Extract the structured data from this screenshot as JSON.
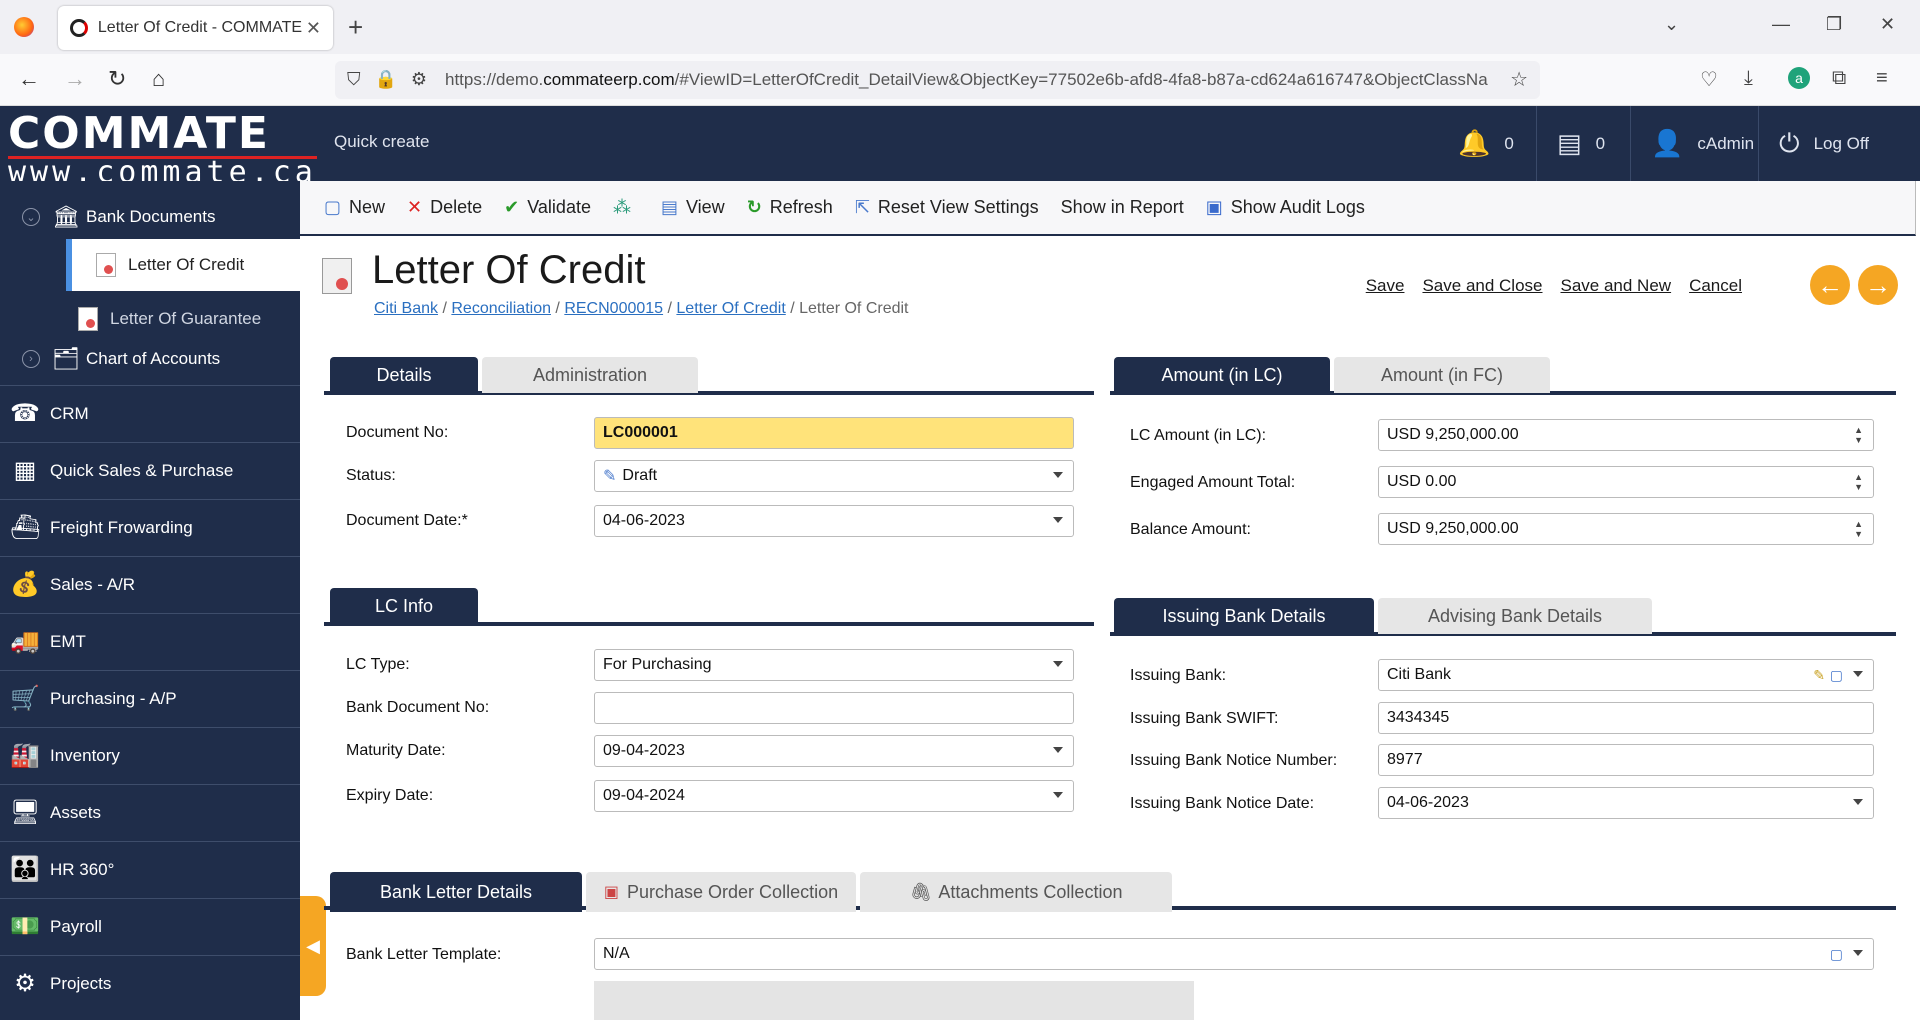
{
  "browser": {
    "tab_title": "Letter Of Credit - COMMATE ERP",
    "url_prefix": "https://demo.",
    "url_domain": "commateerp.com",
    "url_rest": "/#ViewID=LetterOfCredit_DetailView&ObjectKey=77502e6b-afd8-4fa8-b87a-cd624a616747&ObjectClassNa"
  },
  "header": {
    "logo_main": "COMMATE",
    "logo_sub": "www.commate.ca",
    "quick_create": "Quick create",
    "notifications_count": "0",
    "tasks_count": "0",
    "user": "cAdmin",
    "logoff": "Log Off"
  },
  "sidebar": {
    "bank_documents": "Bank Documents",
    "letter_of_credit": "Letter Of Credit",
    "letter_of_guarantee": "Letter Of Guarantee",
    "chart_of_accounts": "Chart of Accounts",
    "menu": [
      "CRM",
      "Quick Sales & Purchase",
      "Freight Frowarding",
      "Sales - A/R",
      "EMT",
      "Purchasing - A/P",
      "Inventory",
      "Assets",
      "HR 360°",
      "Payroll",
      "Projects"
    ]
  },
  "toolbar": {
    "new": "New",
    "delete": "Delete",
    "validate": "Validate",
    "view": "View",
    "refresh": "Refresh",
    "reset_view": "Reset View Settings",
    "show_in_report": "Show in Report",
    "show_audit_logs": "Show Audit Logs"
  },
  "page": {
    "title": "Letter Of Credit",
    "breadcrumb": [
      "Citi Bank",
      "Reconciliation",
      "RECN000015",
      "Letter Of Credit"
    ],
    "breadcrumb_current": "Letter Of Credit",
    "actions": [
      "Save",
      "Save and Close",
      "Save and New",
      "Cancel"
    ]
  },
  "details": {
    "tabs": [
      "Details",
      "Administration"
    ],
    "document_no_label": "Document No:",
    "document_no": "LC000001",
    "status_label": "Status:",
    "status": "Draft",
    "document_date_label": "Document Date:*",
    "document_date": "04-06-2023"
  },
  "amount": {
    "tabs": [
      "Amount (in LC)",
      "Amount (in FC)"
    ],
    "lc_amount_label": "LC Amount (in LC):",
    "lc_amount": "USD 9,250,000.00",
    "engaged_label": "Engaged Amount Total:",
    "engaged": "USD 0.00",
    "balance_label": "Balance Amount:",
    "balance": "USD 9,250,000.00"
  },
  "lc_info": {
    "tab": "LC Info",
    "lc_type_label": "LC Type:",
    "lc_type": "For Purchasing",
    "bank_doc_label": "Bank Document No:",
    "bank_doc": "",
    "maturity_label": "Maturity Date:",
    "maturity": "09-04-2023",
    "expiry_label": "Expiry Date:",
    "expiry": "09-04-2024"
  },
  "bank": {
    "tabs": [
      "Issuing Bank Details",
      "Advising Bank Details"
    ],
    "issuing_bank_label": "Issuing Bank:",
    "issuing_bank": "Citi Bank",
    "swift_label": "Issuing Bank SWIFT:",
    "swift": "3434345",
    "notice_no_label": "Issuing Bank Notice Number:",
    "notice_no": "8977",
    "notice_date_label": "Issuing Bank Notice Date:",
    "notice_date": "04-06-2023"
  },
  "letter": {
    "tabs": [
      "Bank Letter Details",
      "Purchase Order Collection",
      "Attachments Collection"
    ],
    "template_label": "Bank Letter Template:",
    "template": "N/A"
  }
}
